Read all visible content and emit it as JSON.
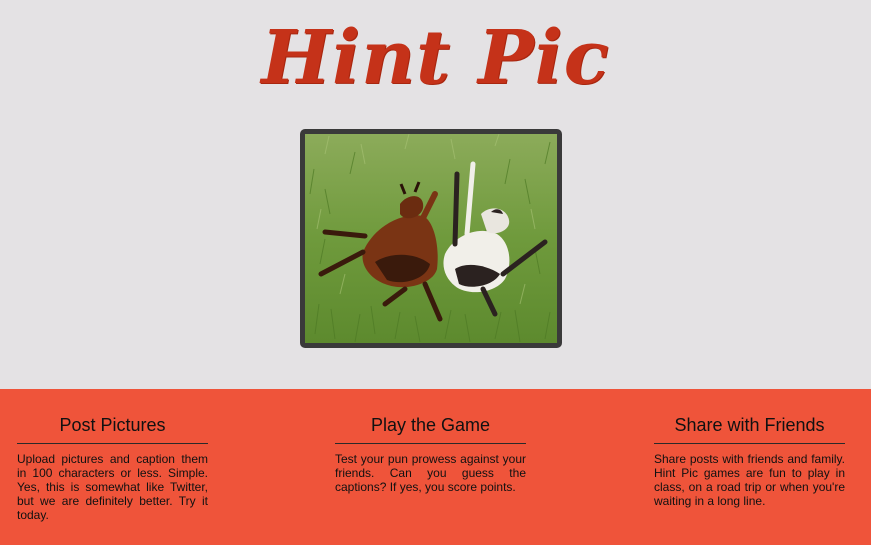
{
  "header": {
    "logo_text": "Hint Pic",
    "logo_color": "#c53219"
  },
  "hero": {
    "image_subject": "two goats rolling in green grass"
  },
  "features": [
    {
      "title": "Post Pictures",
      "text": "Upload pictures and caption them in 100 characters or less. Simple. Yes, this is somewhat like Twitter, but we are definitely better. Try it today."
    },
    {
      "title": "Play the Game",
      "text": "Test your pun prowess against your friends. Can you guess the captions? If yes, you score points."
    },
    {
      "title": "Share with Friends",
      "text": "Share posts with friends and family. Hint Pic games are fun to play in class, on a road trip or when you're waiting in a long line."
    }
  ],
  "colors": {
    "background": "#e4e2e4",
    "band": "#ef543a"
  }
}
